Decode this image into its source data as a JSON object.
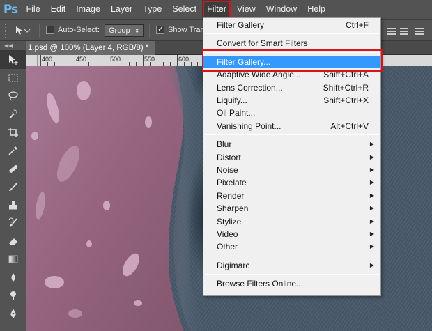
{
  "app": {
    "logo": "Ps"
  },
  "menubar": {
    "items": [
      "File",
      "Edit",
      "Image",
      "Layer",
      "Type",
      "Select",
      "Filter",
      "View",
      "Window",
      "Help"
    ],
    "active": "Filter"
  },
  "options": {
    "auto_select_label": "Auto-Select:",
    "auto_select_value": "Group",
    "show_transform_label": "Show Trans"
  },
  "document": {
    "tab_label": "1.psd @ 100% (Layer 4, RGB/8) *",
    "ruler_labels": [
      "400",
      "450",
      "500",
      "550",
      "600",
      "650",
      "700",
      "750",
      "800",
      "850"
    ]
  },
  "filter_menu": {
    "items": [
      {
        "label": "Filter Gallery",
        "shortcut": "Ctrl+F"
      },
      {
        "separator": true
      },
      {
        "label": "Convert for Smart Filters"
      },
      {
        "separator": true
      },
      {
        "label": "Filter Gallery...",
        "highlighted": true
      },
      {
        "label": "Adaptive Wide Angle...",
        "shortcut": "Shift+Ctrl+A"
      },
      {
        "label": "Lens Correction...",
        "shortcut": "Shift+Ctrl+R"
      },
      {
        "label": "Liquify...",
        "shortcut": "Shift+Ctrl+X"
      },
      {
        "label": "Oil Paint..."
      },
      {
        "label": "Vanishing Point...",
        "shortcut": "Alt+Ctrl+V"
      },
      {
        "separator": true
      },
      {
        "label": "Blur",
        "submenu": true
      },
      {
        "label": "Distort",
        "submenu": true
      },
      {
        "label": "Noise",
        "submenu": true
      },
      {
        "label": "Pixelate",
        "submenu": true
      },
      {
        "label": "Render",
        "submenu": true
      },
      {
        "label": "Sharpen",
        "submenu": true
      },
      {
        "label": "Stylize",
        "submenu": true
      },
      {
        "label": "Video",
        "submenu": true
      },
      {
        "label": "Other",
        "submenu": true
      },
      {
        "separator": true
      },
      {
        "label": "Digimarc",
        "submenu": true
      },
      {
        "separator": true
      },
      {
        "label": "Browse Filters Online..."
      }
    ]
  },
  "tools": [
    "move-tool-icon",
    "marquee-tool-icon",
    "lasso-tool-icon",
    "quick-select-tool-icon",
    "crop-tool-icon",
    "eyedropper-tool-icon",
    "healing-brush-tool-icon",
    "brush-tool-icon",
    "clone-stamp-tool-icon",
    "history-brush-tool-icon",
    "eraser-tool-icon",
    "gradient-tool-icon",
    "blur-tool-icon",
    "dodge-tool-icon",
    "pen-tool-icon"
  ],
  "colors": {
    "highlight": "#3399ff",
    "annotation": "#d6141a",
    "ui_dark": "#535353"
  }
}
